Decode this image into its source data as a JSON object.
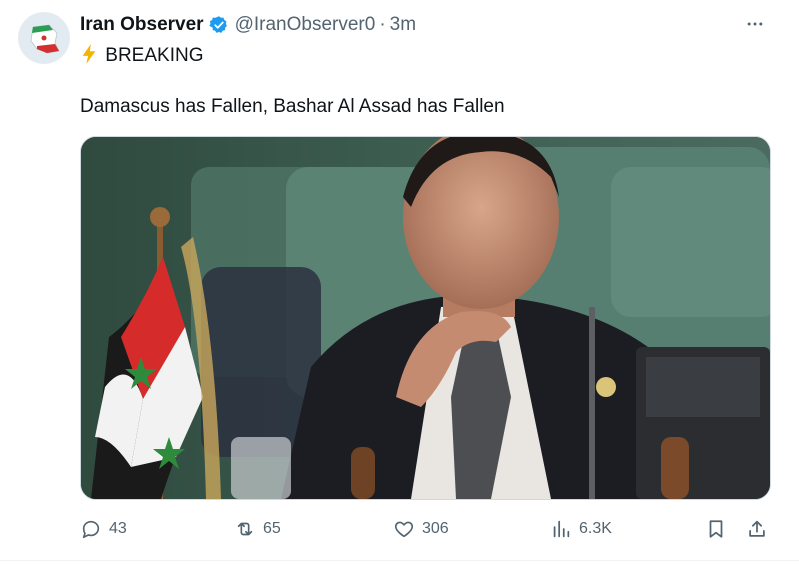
{
  "tweet": {
    "author": {
      "name": "Iran Observer",
      "handle": "@IranObserver0",
      "time_separator": "·",
      "time": "3m"
    },
    "breaking": "BREAKING",
    "text": "Damascus has Fallen, Bashar Al Assad has Fallen",
    "actions": {
      "replies": "43",
      "reposts": "65",
      "likes": "306",
      "views": "6.3K"
    }
  },
  "colors": {
    "verified": "#1d9bf0",
    "secondary_text": "#536471",
    "bolt": "#f4b400"
  },
  "icons": [
    "verified-badge-icon",
    "more-icon",
    "reply-icon",
    "repost-icon",
    "like-icon",
    "views-icon",
    "bookmark-icon",
    "share-icon"
  ]
}
